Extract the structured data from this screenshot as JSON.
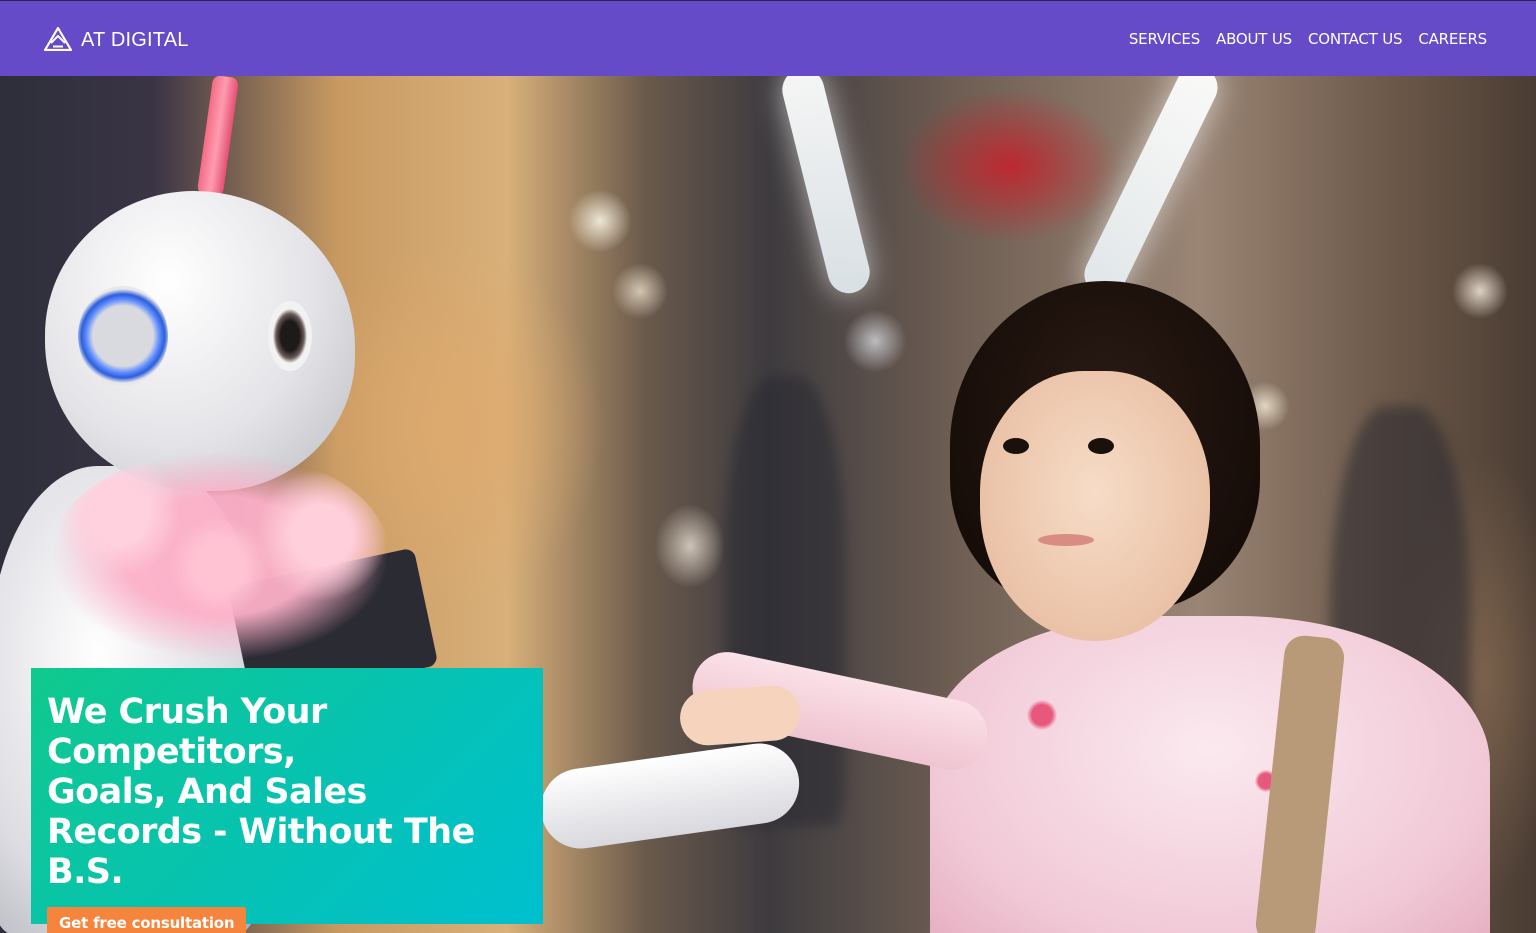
{
  "header": {
    "brand": "AT DIGITAL",
    "nav": [
      {
        "label": "SERVICES"
      },
      {
        "label": "ABOUT US"
      },
      {
        "label": "CONTACT US"
      },
      {
        "label": "CAREERS"
      }
    ]
  },
  "hero": {
    "title": "We Crush Your Competitors,\nGoals, And Sales Records - Without The B.S.",
    "cta_label": "Get free consultation",
    "image": "robot-and-child-photo"
  },
  "colors": {
    "nav_bg": "#654bc8",
    "card_gradient_start": "#10c98d",
    "card_gradient_end": "#00c0cf",
    "cta_bg": "#f6843c"
  }
}
